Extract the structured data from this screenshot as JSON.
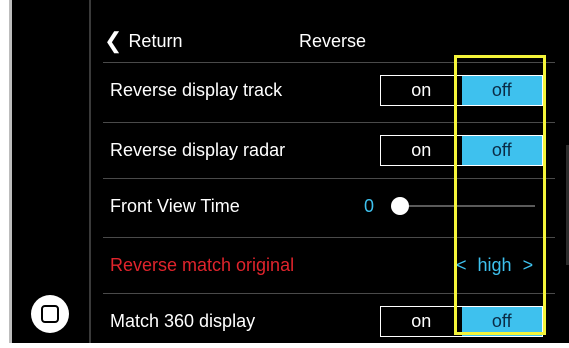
{
  "header": {
    "return_label": "Return",
    "title": "Reverse"
  },
  "settings": [
    {
      "label": "Reverse display track",
      "type": "toggle",
      "on_label": "on",
      "off_label": "off",
      "selected": "off"
    },
    {
      "label": "Reverse display radar",
      "type": "toggle",
      "on_label": "on",
      "off_label": "off",
      "selected": "off"
    },
    {
      "label": "Front View Time",
      "type": "slider",
      "value": "0",
      "level": 0
    },
    {
      "label": "Reverse match original",
      "type": "selector",
      "prev": "<",
      "value": "high",
      "next": ">",
      "label_color": "#e0242c"
    },
    {
      "label": "Match 360 display",
      "type": "toggle",
      "on_label": "on",
      "off_label": "off",
      "selected": "off"
    }
  ],
  "colors": {
    "accent": "#3ec1ee",
    "highlight": "#f4f43a",
    "warning_text": "#e0242c",
    "background": "#000000"
  },
  "icons": {
    "return": "chevron-left-icon",
    "home": "home-square-icon"
  }
}
